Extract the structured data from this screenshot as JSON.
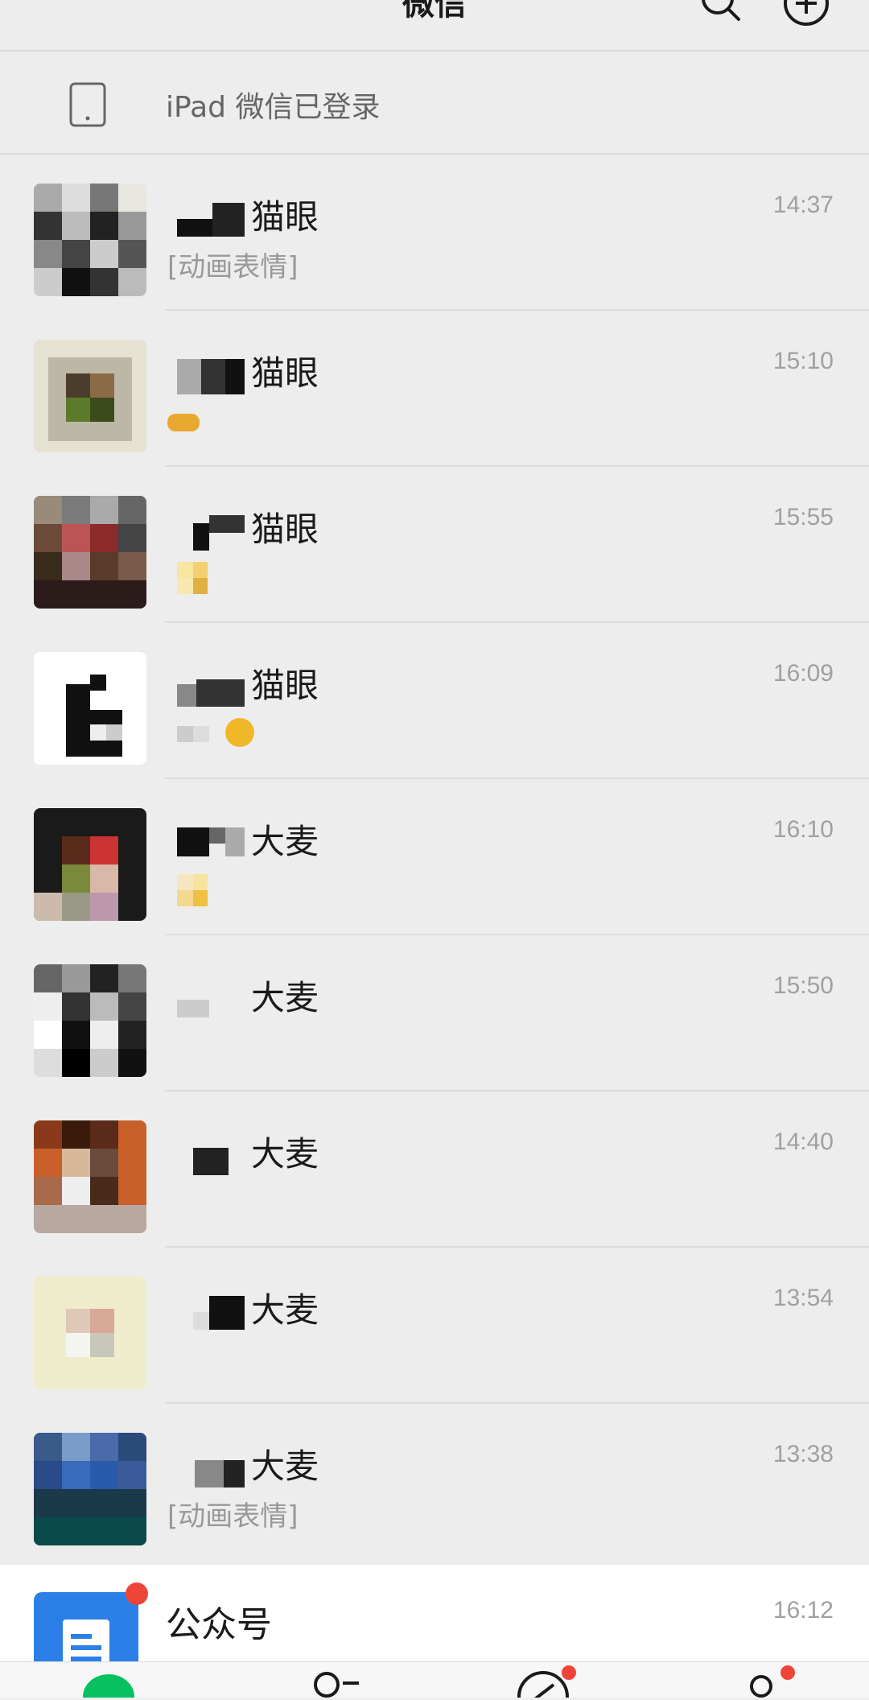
{
  "header": {
    "title": "微信",
    "search_icon": "search-icon",
    "add_icon": "plus-circle-icon"
  },
  "device_bar": {
    "icon": "tablet-icon",
    "text": "iPad 微信已登录"
  },
  "chats": [
    {
      "name": "猫眼",
      "time": "14:37",
      "preview": "[动画表情]"
    },
    {
      "name": "猫眼",
      "time": "15:10",
      "preview": ""
    },
    {
      "name": "猫眼",
      "time": "15:55",
      "preview": ""
    },
    {
      "name": "猫眼",
      "time": "16:09",
      "preview": ""
    },
    {
      "name": "大麦",
      "time": "16:10",
      "preview": ""
    },
    {
      "name": "大麦",
      "time": "15:50",
      "preview": ""
    },
    {
      "name": "大麦",
      "time": "14:40",
      "preview": ""
    },
    {
      "name": "大麦",
      "time": "13:54",
      "preview": ""
    },
    {
      "name": "大麦",
      "time": "13:38",
      "preview": "[动画表情]"
    }
  ],
  "official_accounts": {
    "name": "公众号",
    "time": "16:12",
    "preview": "",
    "badge_color": "#f04438",
    "icon_color": "#2b7fe6"
  },
  "tabbar": {
    "tabs": [
      {
        "icon": "chat-bubble-icon",
        "active": true
      },
      {
        "icon": "contacts-icon",
        "active": false
      },
      {
        "icon": "compass-icon",
        "active": false,
        "badge": true
      },
      {
        "icon": "me-icon",
        "active": false,
        "badge": true
      }
    ]
  },
  "colors": {
    "background": "#ededed",
    "accent_green": "#07c160",
    "badge_red": "#f04438"
  }
}
